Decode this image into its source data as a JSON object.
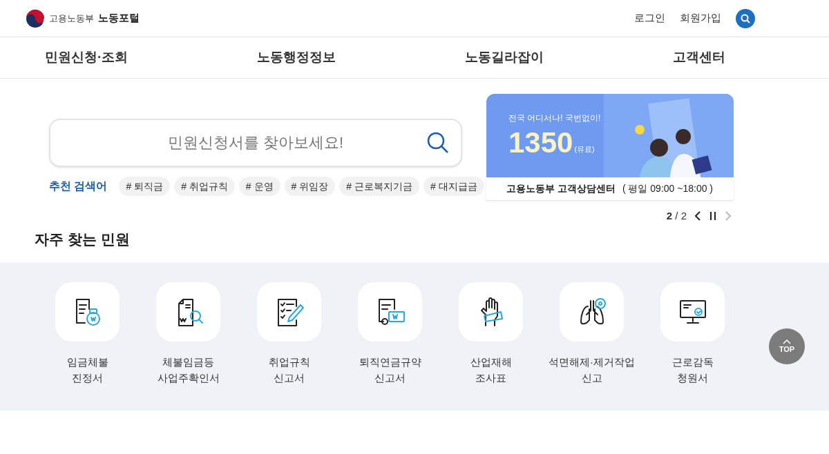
{
  "header": {
    "ministry": "고용노동부",
    "portal": "노동포털",
    "links": [
      "로그인",
      "회원가입"
    ]
  },
  "nav": [
    "민원신청·조회",
    "노동행정정보",
    "노동길라잡이",
    "고객센터"
  ],
  "search": {
    "placeholder": "민원신청서를 찾아보세요!",
    "recommend_label": "추천 검색어",
    "tags": [
      "# 퇴직금",
      "# 취업규칙",
      "# 운영",
      "# 위임장",
      "# 근로복지기금",
      "# 대지급금"
    ]
  },
  "banner": {
    "tagline": "전국 어디서나! 국번없이!",
    "number": "1350",
    "note": "(유료)",
    "caption": "고용노동부 고객상담센터",
    "hours": "( 평일 09:00 ~18:00 )",
    "pager": {
      "current": "2",
      "separator": "/",
      "total": "2",
      "prev_disabled": false,
      "next_disabled": true
    }
  },
  "frequent": {
    "title": "자주 찾는 민원",
    "items": [
      {
        "kind": "wage",
        "lines": [
          "임금체불",
          "진정서"
        ]
      },
      {
        "kind": "confirm",
        "lines": [
          "체불임금등",
          "사업주확인서"
        ]
      },
      {
        "kind": "rules",
        "lines": [
          "취업규칙",
          "신고서"
        ]
      },
      {
        "kind": "pension",
        "lines": [
          "퇴직연금규약",
          "신고서"
        ]
      },
      {
        "kind": "injury",
        "lines": [
          "산업재해",
          "조사표"
        ]
      },
      {
        "kind": "asbestos",
        "lines": [
          "석면해제·제거작업",
          "신고"
        ]
      },
      {
        "kind": "inspect",
        "lines": [
          "근로감독",
          "청원서"
        ]
      }
    ]
  },
  "top_button": "TOP"
}
